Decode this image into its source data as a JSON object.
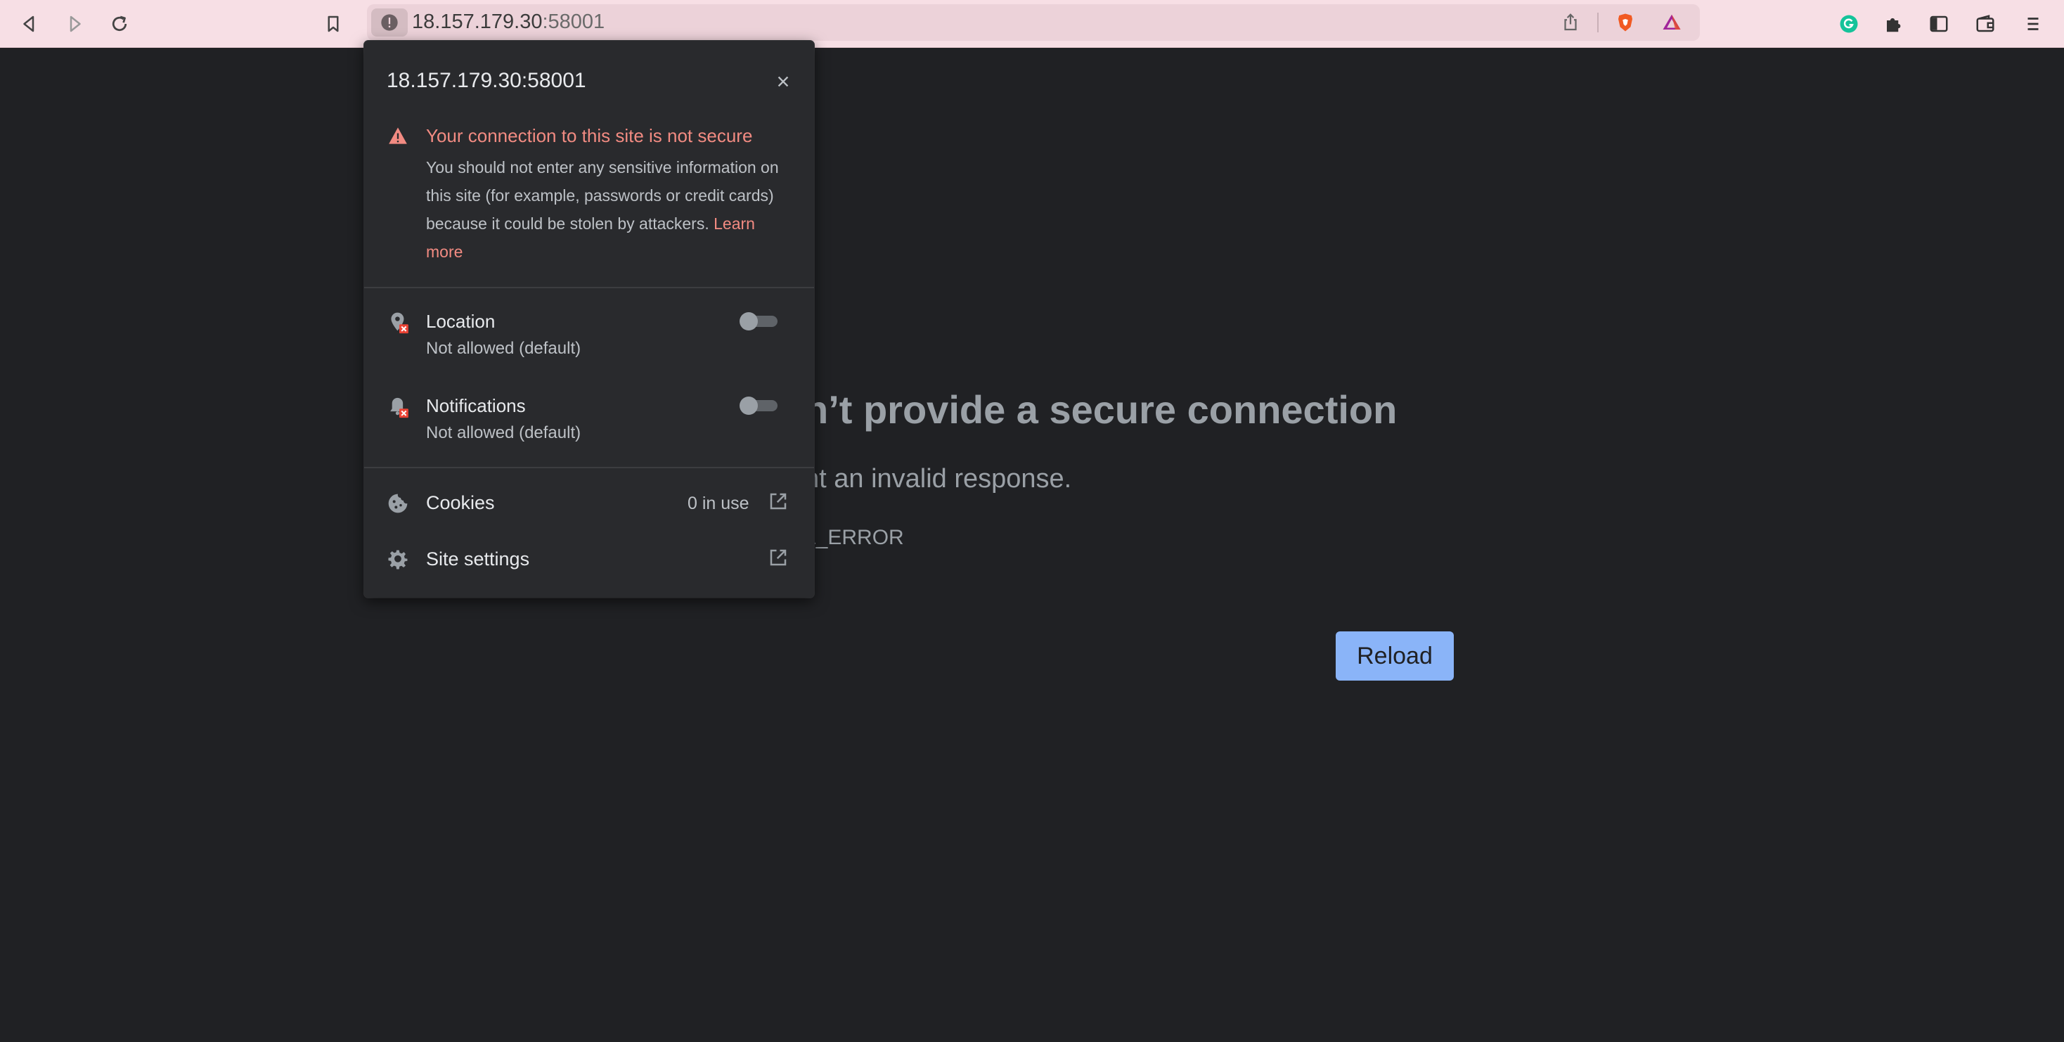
{
  "browser": {
    "url_host": "18.157.179.30",
    "url_port": ":58001",
    "colors": {
      "toolbar": "#f7dfe5",
      "accent": "#8ab4f8",
      "warning": "#f28b82"
    }
  },
  "toolbar_icons": [
    "back-icon",
    "forward-icon",
    "reload-icon",
    "bookmark-icon",
    "info-icon",
    "share-icon",
    "brave-shields-icon",
    "brave-rewards-icon",
    "grammarly-icon",
    "extensions-icon",
    "sidebar-icon",
    "wallet-icon",
    "menu-icon"
  ],
  "page": {
    "title_fragment": "n’t provide a secure connection",
    "subtitle_fragment": "nt an invalid response.",
    "error_code_fragment": "L_ERROR",
    "reload_label": "Reload"
  },
  "popup": {
    "header": "18.157.179.30:58001",
    "warning_title": "Your connection to this site is not secure",
    "warning_body": "You should not enter any sensitive information on this site (for example, passwords or credit cards) because it could be stolen by attackers.",
    "learn_more": "Learn more",
    "permissions": [
      {
        "label": "Location",
        "status": "Not allowed (default)",
        "enabled": false
      },
      {
        "label": "Notifications",
        "status": "Not allowed (default)",
        "enabled": false
      }
    ],
    "cookies_label": "Cookies",
    "cookies_value": "0 in use",
    "site_settings_label": "Site settings"
  }
}
